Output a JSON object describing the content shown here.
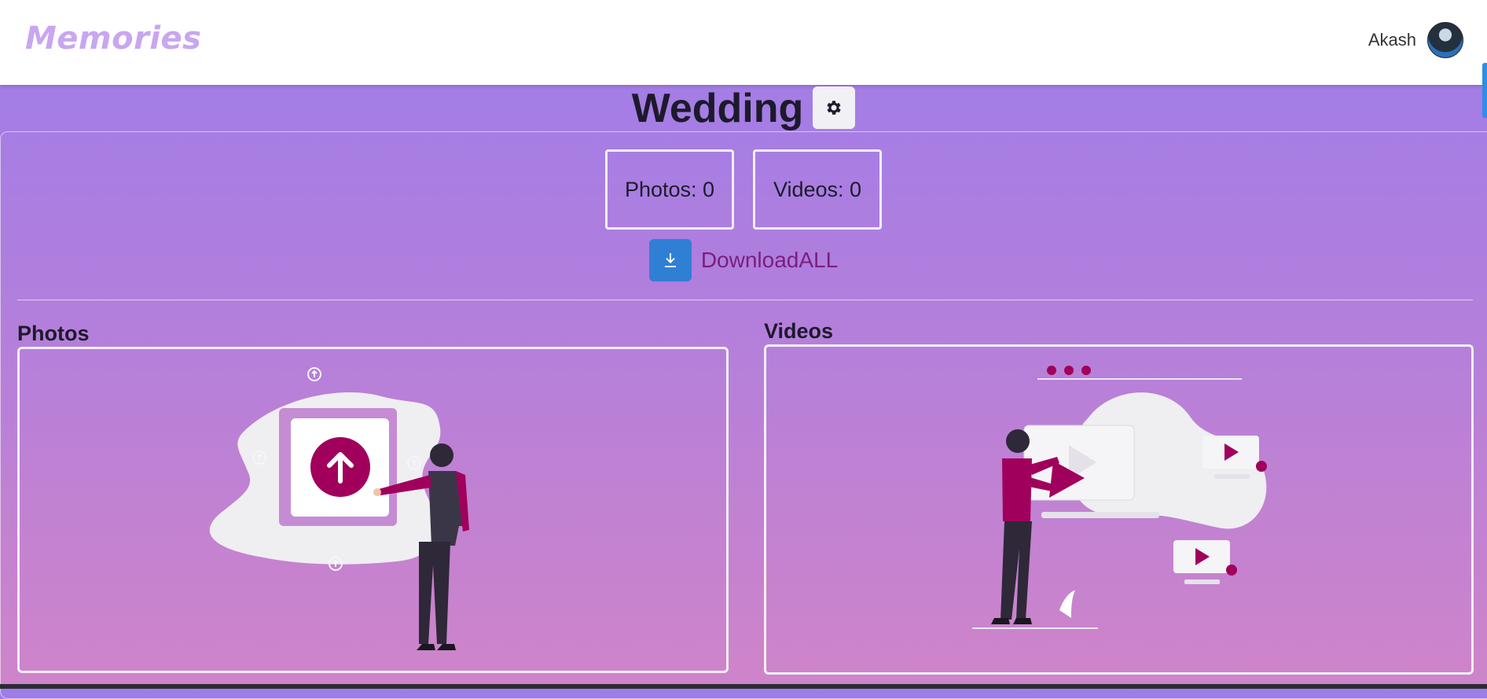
{
  "navbar": {
    "brand": "Memories",
    "user_name": "Akash",
    "avatar_icon": "user-avatar"
  },
  "event": {
    "title": "Wedding",
    "settings_icon": "gear-icon"
  },
  "counts": {
    "photos": "Photos: 0",
    "videos": "Videos: 0"
  },
  "download": {
    "icon": "download-icon",
    "label": "DownloadALL"
  },
  "sections": {
    "photos_title": "Photos",
    "videos_title": "Videos",
    "photos_illustration": "upload-illustration",
    "videos_illustration": "video-upload-illustration"
  },
  "colors": {
    "brand": "#c9a6f0",
    "accent": "#a0005c",
    "download_button": "#2f80d4",
    "download_text": "#7b1e7d",
    "gradient_top": "#9e7ce9",
    "gradient_bottom": "#cf84c9"
  }
}
